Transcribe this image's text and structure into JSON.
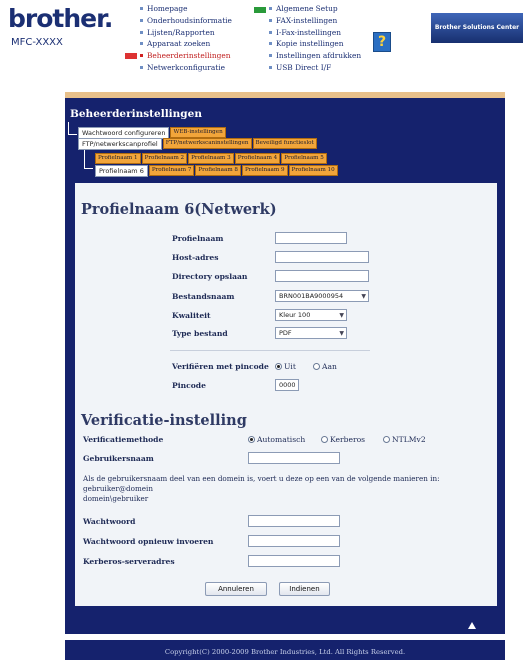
{
  "header": {
    "brand": "brother.",
    "model": "MFC-XXXX",
    "nav_col1": [
      "Homepage",
      "Onderhoudsinformatie",
      "Lijsten/Rapporten",
      "Apparaat zoeken",
      "Beheerderinstellingen",
      "Netwerkconfiguratie"
    ],
    "nav_col2": [
      "Algemene Setup",
      "FAX-instellingen",
      "I-Fax-instellingen",
      "Kopie instellingen",
      "Instellingen afdrukken",
      "USB Direct I/F"
    ],
    "help_icon_glyph": "?",
    "solutions_button": "Brother Solutions Center"
  },
  "admin": {
    "title": "Beheerderinstellingen",
    "tabs_row1": [
      "Wachtwoord configureren",
      "WEB-instellingen"
    ],
    "tabs_row2": [
      "FTP/netwerkscanprofiel",
      "FTP/netwerkscaninstellingen",
      "Beveiligd functieslot"
    ],
    "tabs_row3": [
      "Profielnaam 1",
      "Profielnaam 2",
      "Profielnaam 3",
      "Profielnaam 4",
      "Profielnaam 5"
    ],
    "tabs_row4": [
      "Profielnaam 6",
      "Profielnaam 7",
      "Profielnaam 8",
      "Profielnaam 9",
      "Profielnaam 10"
    ]
  },
  "form": {
    "heading": "Profielnaam 6(Netwerk)",
    "fields": {
      "profile_name": {
        "label": "Profielnaam",
        "value": ""
      },
      "host": {
        "label": "Host-adres",
        "value": ""
      },
      "directory": {
        "label": "Directory opslaan",
        "value": ""
      },
      "filename": {
        "label": "Bestandsnaam",
        "value": "BRN001BA9000954"
      },
      "quality": {
        "label": "Kwaliteit",
        "value": "Kleur 100"
      },
      "filetype": {
        "label": "Type bestand",
        "value": "PDF"
      }
    },
    "pin_verify": {
      "label": "Verifiëren met pincode",
      "off": "Uit",
      "on": "Aan",
      "selected": "Uit"
    },
    "pincode": {
      "label": "Pincode",
      "value": "0000"
    }
  },
  "auth": {
    "heading": "Verificatie-instelling",
    "method_label": "Verificatiemethode",
    "methods": [
      "Automatisch",
      "Kerberos",
      "NTLMv2"
    ],
    "selected_method": "Automatisch",
    "username_label": "Gebruikersnaam",
    "username_value": "",
    "note_line1": "Als de gebruikersnaam deel van een domein is, voert u deze op een van de volgende manieren in:",
    "note_line2": "gebruiker@domein",
    "note_line3": "domein\\gebruiker",
    "password_label": "Wachtwoord",
    "password_repeat_label": "Wachtwoord opnieuw invoeren",
    "kerberos_label": "Kerberos-serveradres"
  },
  "buttons": {
    "cancel": "Annuleren",
    "submit": "Indienen"
  },
  "footer": {
    "copyright": "Copyright(C) 2000-2009 Brother Industries, Ltd. All Rights Reserved."
  },
  "colors": {
    "band": "#15226d",
    "tab": "#f2a53a",
    "panel": "#f1f4f8"
  }
}
